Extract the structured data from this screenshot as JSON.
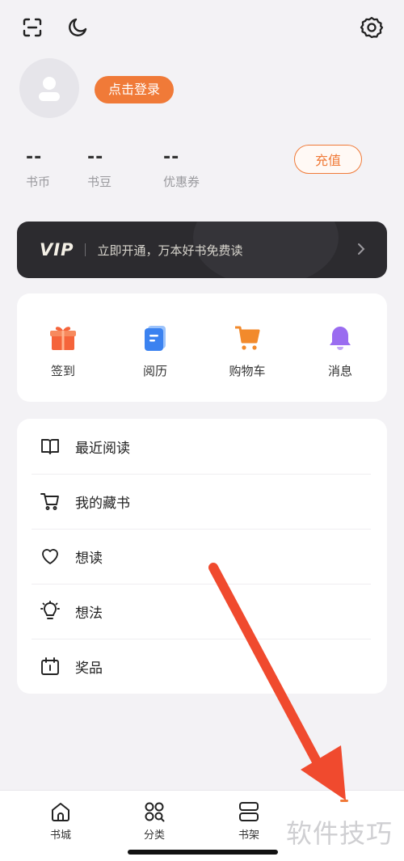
{
  "header": {
    "scan_icon": "scan-icon",
    "night_icon": "moon-icon",
    "settings_icon": "gear-icon"
  },
  "profile": {
    "login_label": "点击登录"
  },
  "stats": [
    {
      "value": "--",
      "label": "书币"
    },
    {
      "value": "--",
      "label": "书豆"
    },
    {
      "value": "--",
      "label": "优惠券"
    }
  ],
  "recharge_label": "充值",
  "vip": {
    "badge": "VIP",
    "text": "立即开通，万本好书免费读"
  },
  "quick_actions": [
    {
      "label": "签到",
      "icon": "gift-icon",
      "color": "#f5643a"
    },
    {
      "label": "阅历",
      "icon": "notebook-icon",
      "color": "#3b82f0"
    },
    {
      "label": "购物车",
      "icon": "cart-icon",
      "color": "#f28a2c"
    },
    {
      "label": "消息",
      "icon": "bell-icon",
      "color": "#9a6cf0"
    }
  ],
  "menu": [
    {
      "label": "最近阅读",
      "icon": "book-open-icon"
    },
    {
      "label": "我的藏书",
      "icon": "cart-outline-icon"
    },
    {
      "label": "想读",
      "icon": "heart-icon"
    },
    {
      "label": "想法",
      "icon": "lightbulb-icon"
    },
    {
      "label": "奖品",
      "icon": "prize-box-icon"
    }
  ],
  "tabs": [
    {
      "label": "书城",
      "icon": "home-icon"
    },
    {
      "label": "分类",
      "icon": "category-icon"
    },
    {
      "label": "书架",
      "icon": "shelf-icon"
    }
  ],
  "watermark": "软件技巧",
  "colors": {
    "accent": "#f07a38",
    "background": "#f3f2f5",
    "vip_bg": "#2c2b2f",
    "arrow": "#f04a2e"
  }
}
